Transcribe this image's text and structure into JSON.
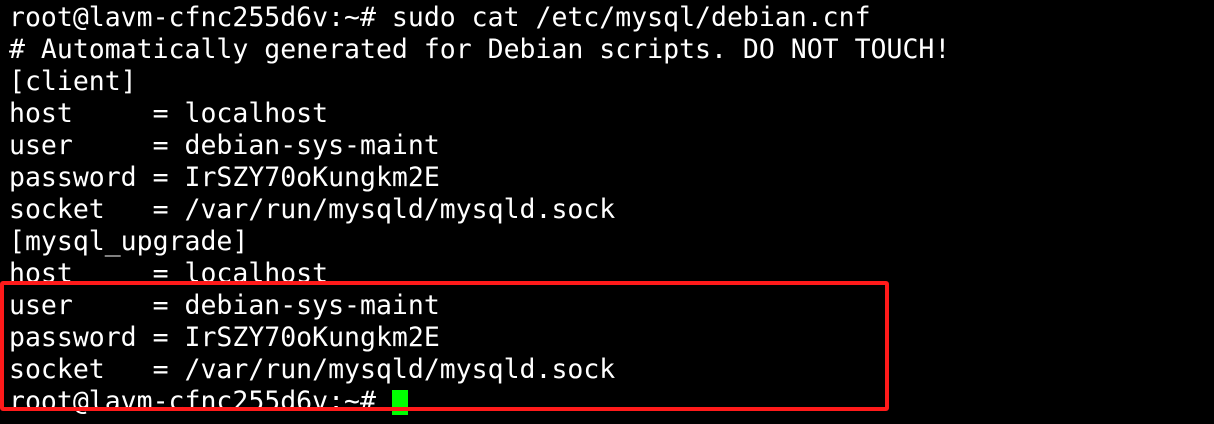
{
  "terminal": {
    "lines": [
      "root@lavm-cfnc255d6v:~# sudo cat /etc/mysql/debian.cnf",
      "# Automatically generated for Debian scripts. DO NOT TOUCH!",
      "[client]",
      "host     = localhost",
      "user     = debian-sys-maint",
      "password = IrSZY70oKungkm2E",
      "socket   = /var/run/mysqld/mysqld.sock",
      "[mysql_upgrade]",
      "host     = localhost",
      "user     = debian-sys-maint",
      "password = IrSZY70oKungkm2E",
      "socket   = /var/run/mysqld/mysqld.sock"
    ],
    "prompt": "root@lavm-cfnc255d6v:~# "
  },
  "colors": {
    "background": "#000000",
    "text": "#ffffff",
    "cursor": "#00ff00",
    "highlight_border": "#ff1a1a"
  }
}
